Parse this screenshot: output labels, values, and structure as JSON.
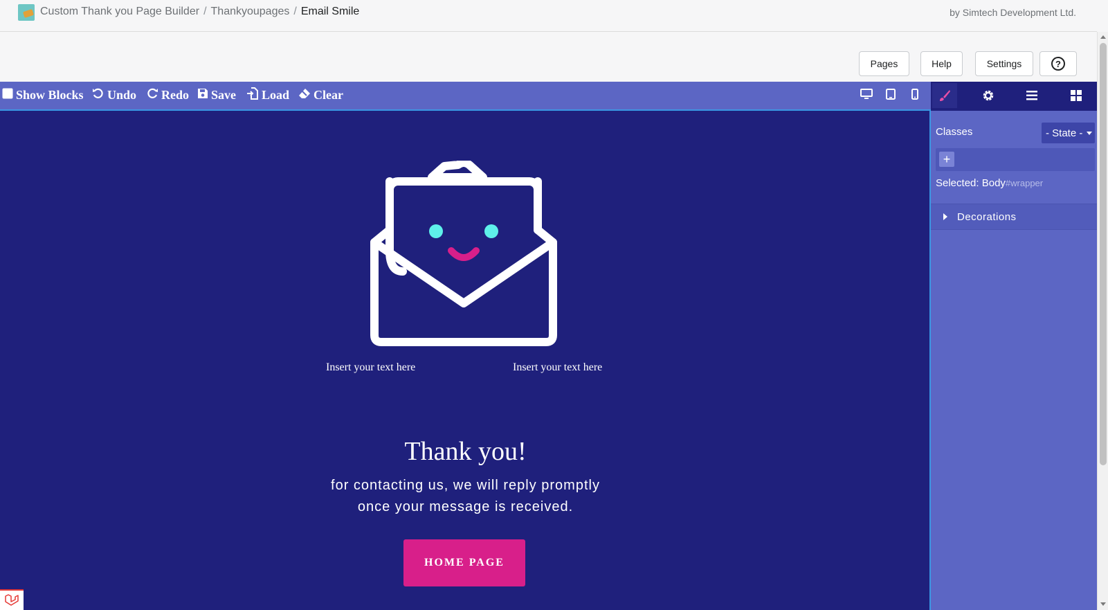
{
  "header": {
    "breadcrumb": [
      "Custom Thank you Page Builder",
      "Thankyoupages",
      "Email Smile"
    ],
    "separator": "/",
    "byline": "by Simtech Development Ltd."
  },
  "actions": {
    "pages": "Pages",
    "help": "Help",
    "settings": "Settings",
    "help_icon": "?"
  },
  "toolbar": {
    "show_blocks": "Show Blocks",
    "undo": "Undo",
    "redo": "Redo",
    "save": "Save",
    "load": "Load",
    "clear": "Clear",
    "devices": [
      "desktop-icon",
      "tablet-icon",
      "mobile-icon"
    ]
  },
  "canvas": {
    "text_left": "Insert your text here",
    "text_right": "Insert your text here",
    "title": "Thank you!",
    "subtitle_line1": "for contacting us, we will reply promptly",
    "subtitle_line2": "once your message is received.",
    "button": "HOME PAGE",
    "colors": {
      "background": "#1f207c",
      "button": "#d81f8a",
      "eyes": "#5ef0ea",
      "smile": "#d81f8a"
    }
  },
  "panel": {
    "tabs": [
      "brush-icon",
      "gear-icon",
      "layers-icon",
      "blocks-icon"
    ],
    "classes_label": "Classes",
    "state_label": "- State -",
    "add_label": "+",
    "selected_label": "Selected:",
    "selected_name": "Body",
    "selected_id": "#wrapper",
    "decorations": "Decorations"
  },
  "colors": {
    "toolbar": "#5c66c4",
    "panel_tabs": "#1f207c",
    "accent": "#3b97e3"
  }
}
